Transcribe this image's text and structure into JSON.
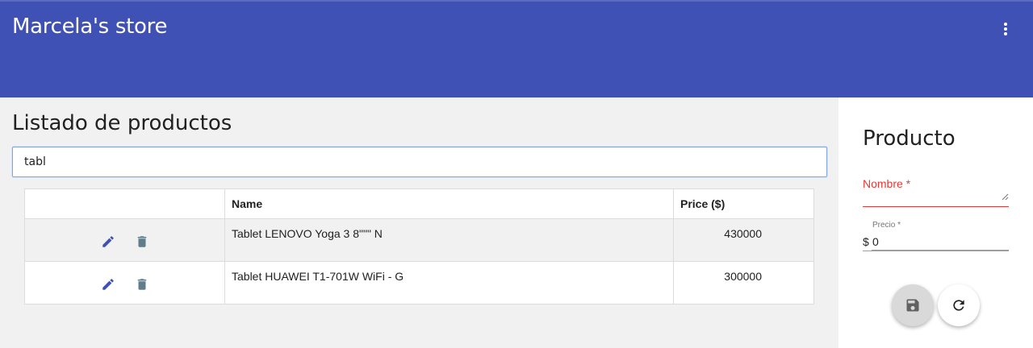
{
  "app": {
    "title": "Marcela's store"
  },
  "list": {
    "title": "Listado de productos",
    "search_value": "tabl",
    "columns": [
      "",
      "Name",
      "Price ($)"
    ],
    "rows": [
      {
        "name": "Tablet LENOVO Yoga 3 8\"\"\" N",
        "price": "430000"
      },
      {
        "name": "Tablet HUAWEI T1-701W WiFi - G",
        "price": "300000"
      }
    ]
  },
  "form": {
    "title": "Producto",
    "name_label": "Nombre *",
    "name_value": "",
    "price_label": "Precio *",
    "price_prefix": "$",
    "price_value": "0"
  },
  "icons": {
    "menu": "more-vert-icon",
    "edit": "pencil-icon",
    "delete": "trash-icon",
    "save": "floppy-disk-icon",
    "reset": "refresh-icon"
  },
  "colors": {
    "primary": "#3f51b5",
    "edit_icon": "#3f51b5",
    "delete_icon": "#607d8b",
    "error": "#e53935"
  }
}
